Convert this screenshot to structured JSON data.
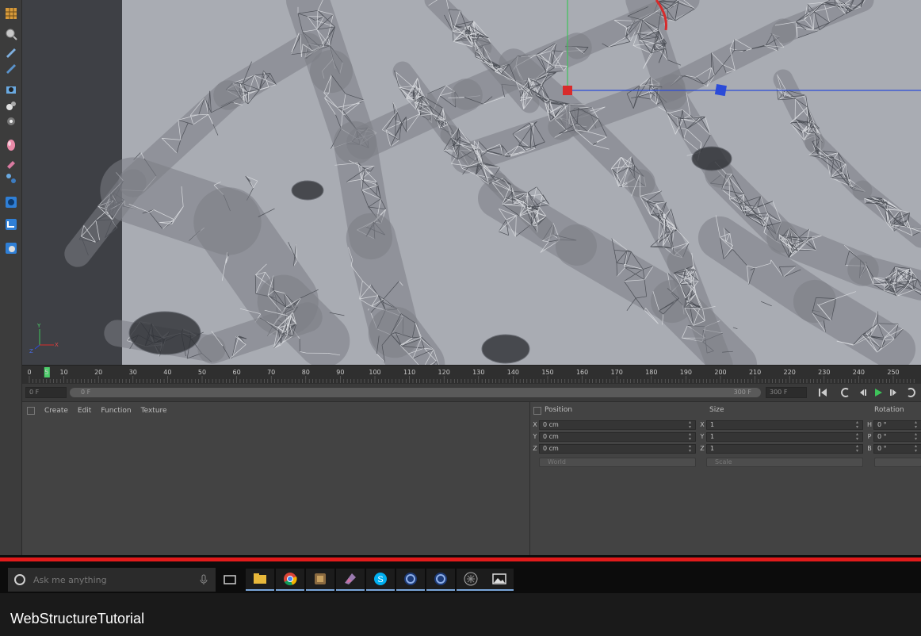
{
  "toolbar": {
    "icons": [
      "grid-icon",
      "magnifier-icon",
      "pen-icon",
      "brush-icon",
      "camera-icon",
      "sphere-icon",
      "light-icon",
      "material-icon",
      "sculpt-icon",
      "paint-icon",
      "render-icon",
      "spline-icon",
      "globe-icon"
    ]
  },
  "viewport": {
    "background": "#a9acb3",
    "mesh_color": "#5e6168",
    "axis_labels": {
      "y": "Y",
      "x": "X",
      "z": "Z"
    },
    "gizmo_colors": {
      "y": "#3ec35a",
      "x": "#d82b2b",
      "z": "#2b4bd8"
    }
  },
  "timeline": {
    "ticks": [
      "0",
      "5",
      "10",
      "20",
      "30",
      "40",
      "50",
      "60",
      "70",
      "80",
      "90",
      "100",
      "110",
      "120",
      "130",
      "140",
      "150",
      "160",
      "170",
      "180",
      "190",
      "200",
      "210",
      "220",
      "230",
      "240",
      "250"
    ],
    "current_frame": "5",
    "playhead_color": "#4ccf6a"
  },
  "transport": {
    "start_frame": "0 F",
    "range_start": "0 F",
    "range_end": "300 F",
    "end_frame": "300 F",
    "buttons": [
      "go-to-start",
      "prev-key",
      "prev-frame",
      "play",
      "next-frame",
      "loop"
    ],
    "play_color": "#3ec35a"
  },
  "material_manager": {
    "menu": [
      "Create",
      "Edit",
      "Function",
      "Texture"
    ]
  },
  "coordinates": {
    "headers": {
      "position": "Position",
      "size": "Size",
      "rotation": "Rotation"
    },
    "position": [
      {
        "axis": "X",
        "value": "0 cm"
      },
      {
        "axis": "Y",
        "value": "0 cm"
      },
      {
        "axis": "Z",
        "value": "0 cm"
      }
    ],
    "size": [
      {
        "axis": "X",
        "value": "1"
      },
      {
        "axis": "Y",
        "value": "1"
      },
      {
        "axis": "Z",
        "value": "1"
      }
    ],
    "rotation": [
      {
        "axis": "H",
        "value": "0 °"
      },
      {
        "axis": "P",
        "value": "0 °"
      },
      {
        "axis": "B",
        "value": "0 °"
      }
    ],
    "mode_select": "World",
    "scale_select": "Scale"
  },
  "video": {
    "progress": 1.0,
    "progress_color": "#e21b1b",
    "title": "WebStructureTutorial"
  },
  "taskbar": {
    "search_placeholder": "Ask me anything",
    "apps": [
      "task-view-icon",
      "file-explorer-icon",
      "chrome-icon",
      "app-icon",
      "photoshop-icon",
      "skype-icon",
      "cinema4d-icon",
      "cinema4d-icon",
      "app-icon",
      "photos-icon"
    ]
  }
}
